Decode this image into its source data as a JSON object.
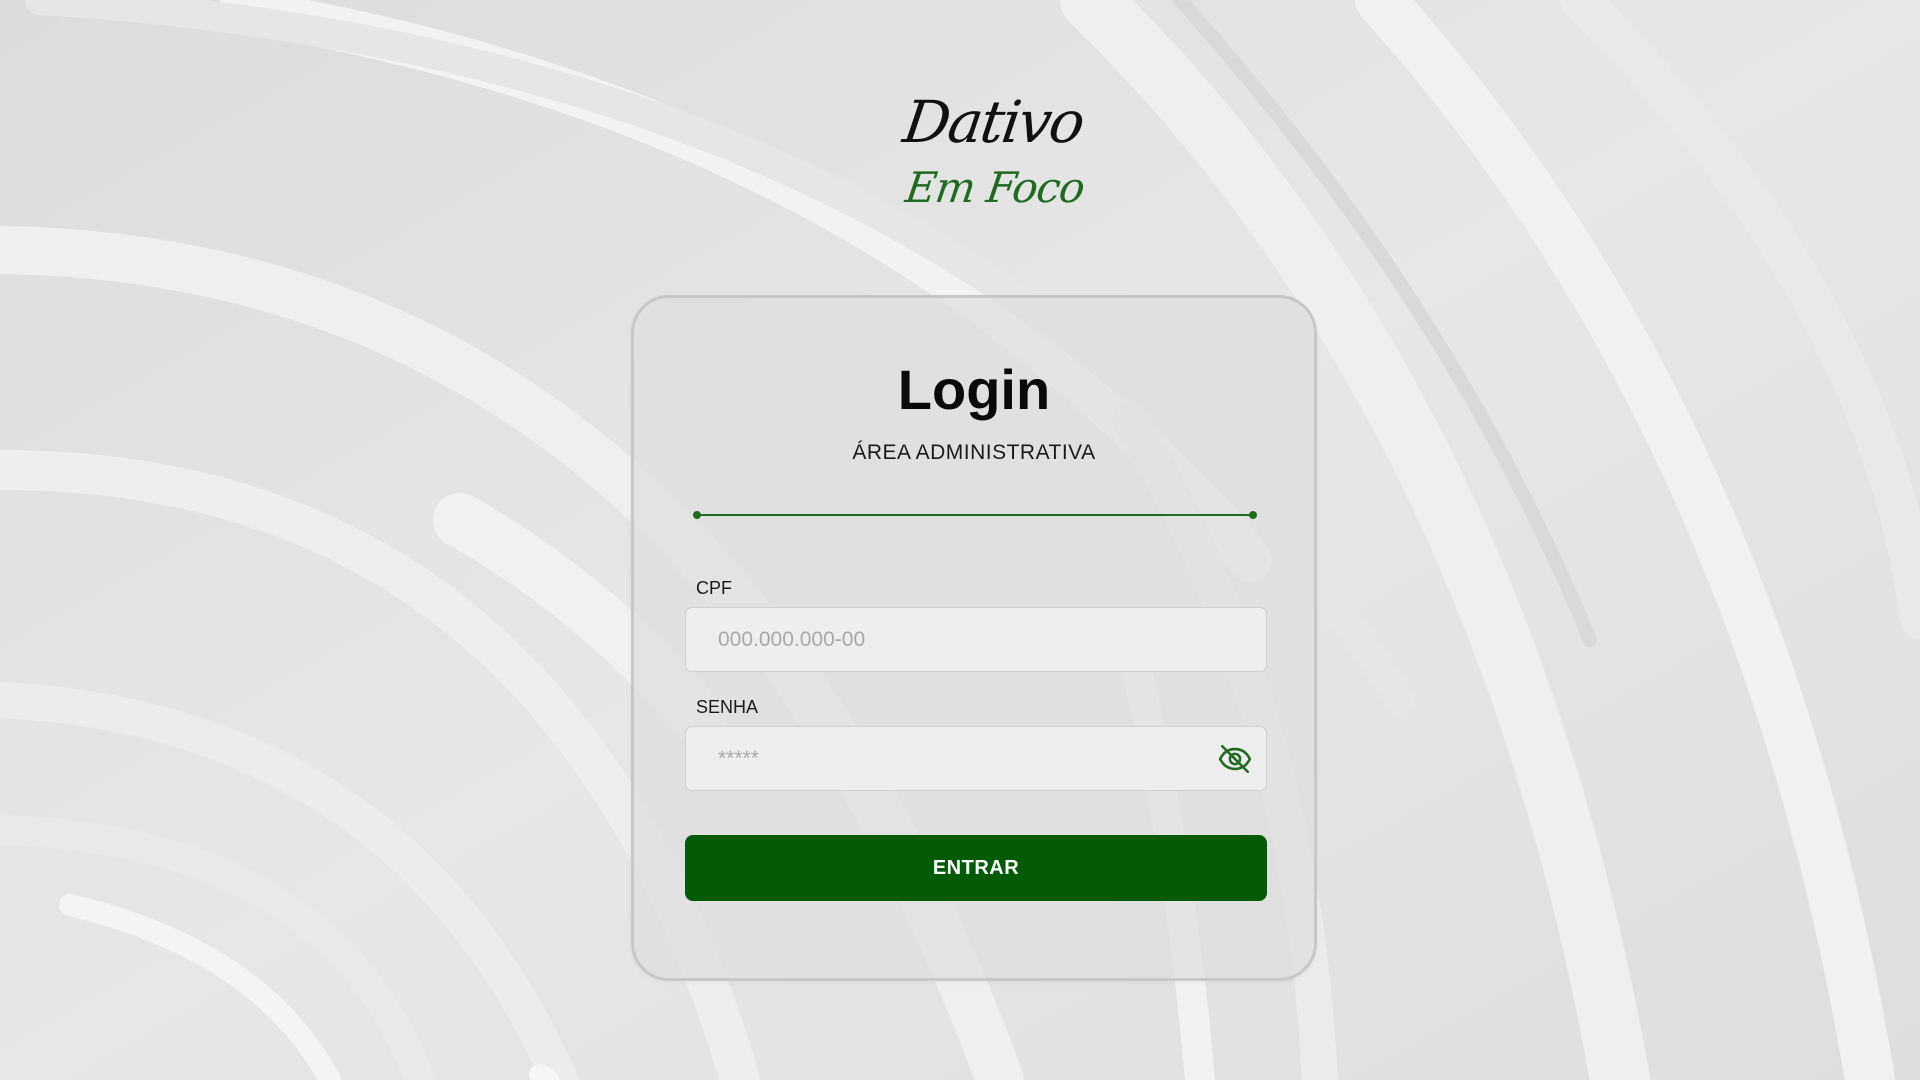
{
  "logo": {
    "line1": "Dativo",
    "line2": "Em Foco"
  },
  "login": {
    "title": "Login",
    "subtitle": "ÁREA ADMINISTRATIVA"
  },
  "form": {
    "cpf": {
      "label": "CPF",
      "placeholder": "000.000.000-00",
      "value": ""
    },
    "senha": {
      "label": "SENHA",
      "placeholder": "*****",
      "value": ""
    },
    "submit_label": "ENTRAR"
  },
  "icons": {
    "password_toggle": "eye-off-icon"
  },
  "colors": {
    "brand_green": "#035a07",
    "accent_green": "#1f6b1f",
    "background": "#e3e3e3",
    "card_border": "#c7c7c7"
  }
}
